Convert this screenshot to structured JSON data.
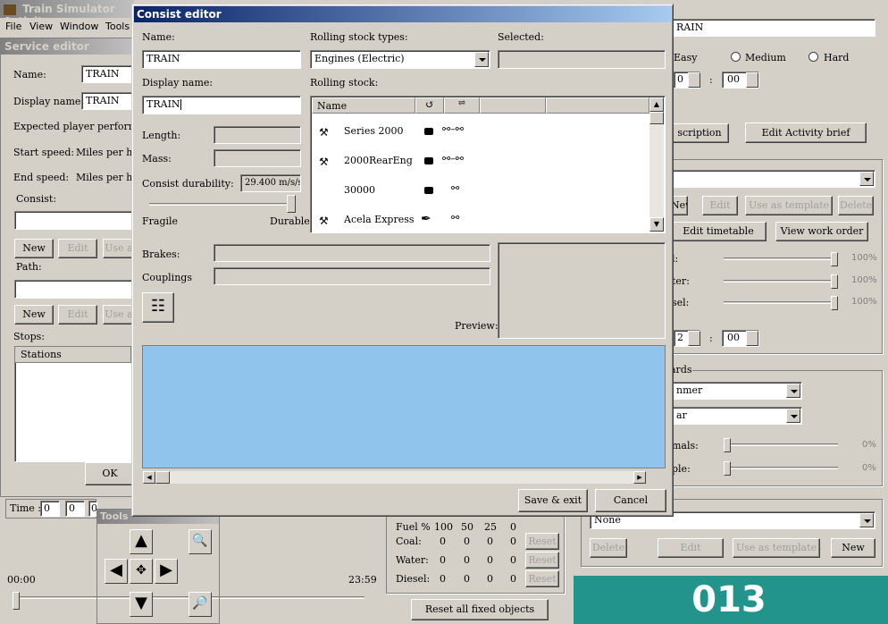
{
  "main_window": {
    "title": "Train Simulator Activit",
    "menu": [
      "File",
      "View",
      "Window",
      "Tools"
    ]
  },
  "service_editor": {
    "title": "Service editor",
    "name_label": "Name:",
    "name_value": "TRAIN",
    "display_name_label": "Display name:",
    "display_name_value": "TRAIN",
    "expected_label": "Expected player performanc",
    "start_speed_label": "Start speed:",
    "start_speed_unit": "Miles per hou",
    "end_speed_label": "End speed:",
    "end_speed_unit": "Miles per hou",
    "consist_label": "Consist:",
    "new_label": "New",
    "edit_label": "Edit",
    "use_label": "Use a",
    "path_label": "Path:",
    "stops_label": "Stops:",
    "stations_header": "Stations",
    "ok_label": "OK"
  },
  "right_panel": {
    "name_value": "RAIN",
    "easy": "Easy",
    "medium": "Medium",
    "hard": "Hard",
    "time_h": "0",
    "time_m": "00",
    "description_button": "scription",
    "edit_brief_button": "Edit Activity brief",
    "new_button": "New",
    "edit_button": "Edit",
    "use_template_button": "Use as template",
    "delete_button": "Delete",
    "edit_timetable_button": "Edit timetable",
    "view_work_order_button": "View work order",
    "fuel_label": "l:",
    "water_label": "ter:",
    "diesel_label": "sel:",
    "pct_100": "100%",
    "time2_h": "2",
    "time2_m": "00",
    "hazards_label": "ards",
    "season_value": "nmer",
    "weather_value": "ar",
    "animals_label": "mals:",
    "people_label": "ple:",
    "pct_0": "0%",
    "none_value": "None",
    "delete2": "Delete",
    "edit2": "Edit",
    "use_template2": "Use as template",
    "new2": "New",
    "badge": "013"
  },
  "time_bar": {
    "label": "Time :",
    "values": [
      "0",
      "0",
      "0"
    ],
    "start": "00:00",
    "end": "23:59"
  },
  "tools": {
    "title": "Tools"
  },
  "fuel_table": {
    "header_label": "Fuel %",
    "headers": [
      "100",
      "50",
      "25",
      "0"
    ],
    "rows": [
      {
        "label": "Coal:",
        "values": [
          "0",
          "0",
          "0",
          "0"
        ],
        "reset": "Reset"
      },
      {
        "label": "Water:",
        "values": [
          "0",
          "0",
          "0",
          "0"
        ],
        "reset": "Reset"
      },
      {
        "label": "Diesel:",
        "values": [
          "0",
          "0",
          "0",
          "0"
        ],
        "reset": "Reset"
      }
    ],
    "reset_all": "Reset all fixed objects"
  },
  "consist_editor": {
    "title": "Consist editor",
    "name_label": "Name:",
    "name_value": "TRAIN",
    "display_name_label": "Display name:",
    "display_name_value": "TRAIN",
    "rolling_types_label": "Rolling stock types:",
    "rolling_types_value": "Engines (Electric)",
    "selected_label": "Selected:",
    "rolling_stock_label": "Rolling stock:",
    "name_col": "Name",
    "items": [
      {
        "name": "Series 2000",
        "icon": "electric-loco-icon",
        "couplers": "chain-coupler-icon"
      },
      {
        "name": "2000RearEng",
        "icon": "electric-loco-icon",
        "couplers": "chain-coupler-icon"
      },
      {
        "name": "30000",
        "icon": "",
        "couplers": "chain-coupler-icon"
      },
      {
        "name": "Acela Express",
        "icon": "electric-loco-icon",
        "couplers": "chain-coupler-icon"
      }
    ],
    "length_label": "Length:",
    "mass_label": "Mass:",
    "durability_label": "Consist durability:",
    "durability_value": "29.400 m/s/s",
    "durability_fraction": 1.0,
    "fragile_label": "Fragile",
    "durable_label": "Durable",
    "brakes_label": "Brakes:",
    "couplings_label": "Couplings",
    "preview_label": "Preview:",
    "save_exit": "Save & exit",
    "cancel": "Cancel",
    "preview_color": "#90c4ec"
  }
}
